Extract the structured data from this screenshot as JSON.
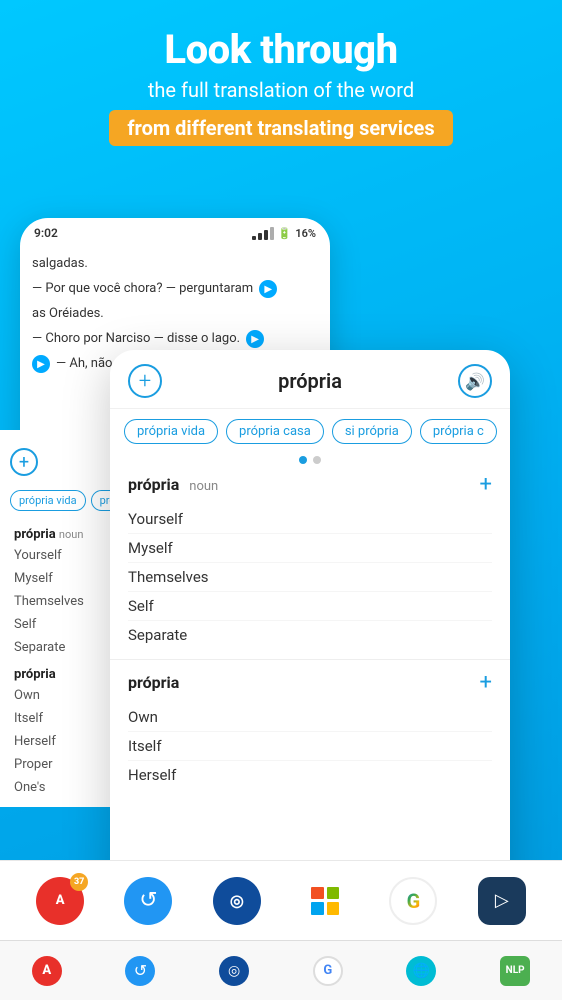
{
  "header": {
    "title": "Look through",
    "subtitle": "the full translation of the word",
    "highlight": "from different translating services"
  },
  "phone_back": {
    "status_time": "9:02",
    "battery": "16%",
    "lines": [
      "salgadas.",
      "— Por que você chora? — perguntaram",
      "as Oréiades.",
      "— Choro por Narciso — disse o lago.",
      "— Ah, não nos espanta que você chore"
    ]
  },
  "left_panel": {
    "chips": [
      "própria vida",
      "próp"
    ],
    "section1": {
      "word": "própria",
      "pos": "noun",
      "items": [
        "Yourself",
        "Myself",
        "Themselves",
        "Self",
        "Separate"
      ]
    },
    "section2": {
      "word": "própria",
      "items": [
        "Own",
        "Itself",
        "Herself",
        "Proper",
        "One's"
      ]
    }
  },
  "main_phone": {
    "topbar": {
      "plus_label": "+",
      "word": "própria",
      "sound_icon": "🔊"
    },
    "chips": [
      "própria vida",
      "própria casa",
      "si própria",
      "própria c"
    ],
    "dots": [
      "active",
      "inactive"
    ],
    "section1": {
      "word": "própria",
      "pos": "noun",
      "items": [
        "Yourself",
        "Myself",
        "Themselves",
        "Self",
        "Separate"
      ]
    },
    "section2": {
      "word": "própria",
      "items": [
        "Own",
        "Itself",
        "Herself"
      ]
    }
  },
  "service_bar": {
    "services": [
      {
        "name": "ABBYY Lingvo",
        "id": "abbyy"
      },
      {
        "name": "Reverso",
        "id": "reverso"
      },
      {
        "name": "DeepL",
        "id": "deepl"
      },
      {
        "name": "Microsoft Translator",
        "id": "microsoft"
      },
      {
        "name": "Google Translate",
        "id": "google"
      },
      {
        "name": "Smartcat",
        "id": "smartcat"
      }
    ]
  },
  "bottom_nav": {
    "items": [
      "A",
      "↺",
      "◎",
      "G",
      "🌐",
      "NLP"
    ]
  },
  "colors": {
    "primary": "#1a9de0",
    "highlight_bg": "#f5a623",
    "background": "#00b4ff"
  }
}
